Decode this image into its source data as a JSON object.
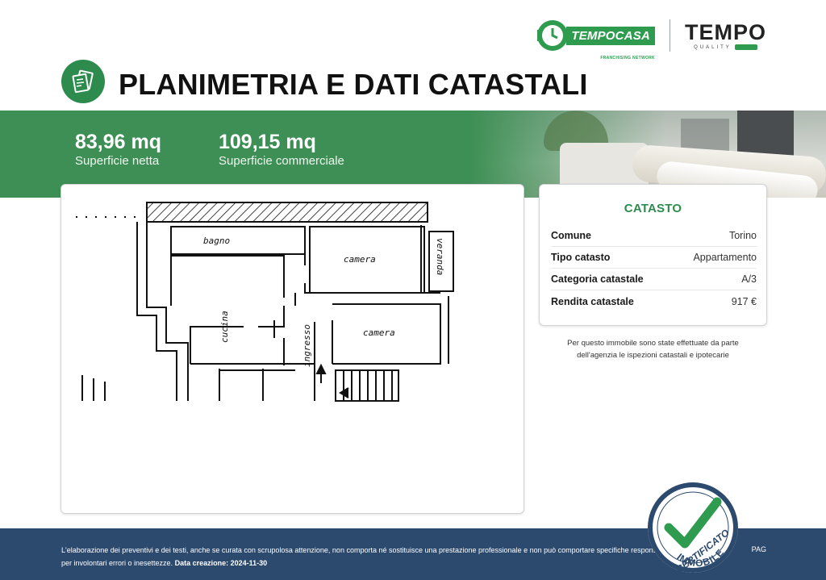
{
  "brand": {
    "tempocasa_logo": "TEMPOCASA",
    "tempocasa_tagline": "FRANCHISING NETWORK",
    "tempo_logo": "TEMPO",
    "tempo_quality": "QUALITY",
    "colors": {
      "green": "#2e8b4e",
      "band_green": "#3e8f55",
      "footer_blue": "#2c4a6e"
    }
  },
  "page": {
    "title": "PLANIMETRIA E DATI CATASTALI",
    "title_icon": "floorplan-documents-icon"
  },
  "stats": [
    {
      "value": "83,96 mq",
      "label": "Superficie netta"
    },
    {
      "value": "109,15 mq",
      "label": "Superficie commerciale"
    }
  ],
  "floorplan": {
    "room_labels": [
      "bagno",
      "camera",
      "veranda",
      "cucina",
      "ingresso",
      "camera"
    ]
  },
  "catasto": {
    "title": "CATASTO",
    "rows": [
      {
        "key": "Comune",
        "value": "Torino"
      },
      {
        "key": "Tipo catasto",
        "value": "Appartamento"
      },
      {
        "key": "Categoria catastale",
        "value": "A/3"
      },
      {
        "key": "Rendita catastale",
        "value": "917 €"
      }
    ],
    "note_line1": "Per questo immobile sono state effettuate da parte",
    "note_line2": "dell'agenzia le ispezioni catastali e ipotecarie"
  },
  "footer": {
    "line1": "L'elaborazione dei preventivi e dei testi, anche se curata con scrupolosa attenzione, non comporta né sostituisce una prestazione professionale e non può comportare specifiche responsabilità",
    "line2_prefix": "per involontari errori o inesettezze.",
    "line2_bold": "Data creazione: 2024-11-30",
    "page_label": "PAG"
  },
  "seal": {
    "line1": "IMMOBILE",
    "line2": "CERTIFICATO",
    "icon": "checkmark-icon"
  }
}
